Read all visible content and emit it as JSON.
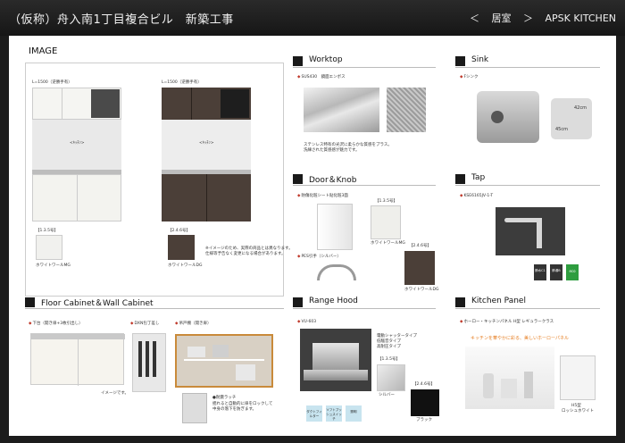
{
  "header": {
    "title": "（仮称）舟入南1丁目複合ビル　新築工事",
    "crumb_left": "＜",
    "crumb_room": "居室",
    "crumb_right": "＞",
    "crumb_brand": "APSK KITCHEN"
  },
  "image_section": {
    "title": "IMAGE",
    "left_label": "L=1500（逆勝手有）",
    "right_label": "L=1500（逆勝手有）",
    "left_hood_text": "<ｷｯﾁﾝ>",
    "right_hood_text": "<ｷｯﾁﾝ>",
    "swatch1_code": "【1.3.5号】",
    "swatch1_name": "ホワイトワールMG",
    "swatch2_code": "【2.4.6号】",
    "swatch2_name": "ホワイトワールDG",
    "note1": "※イメージのため、実際の商品とは異なります。",
    "note2": "仕様等予告なく変更になる場合があります。"
  },
  "worktop": {
    "title": "Worktop",
    "spec": "SUS430　鏡面エンボス",
    "desc1": "ステンレス特有の光沢に柔らかな質感をプラス。",
    "desc2": "洗練された質感感が魅力です。"
  },
  "sink": {
    "title": "Sink",
    "spec": "Fシンク",
    "dim_w": "42cm",
    "dim_h": "45cm"
  },
  "door": {
    "title": "Door＆Knob",
    "spec": "防傷化粧シート貼化粧3面",
    "code1": "【1.3.5号】",
    "name1": "ホワイトワールMG",
    "code2": "【2.4.6号】",
    "name2": "ホワイトワールDG",
    "knob": "PES引手（シルバー）"
  },
  "tap": {
    "title": "Tap",
    "spec": "KSE6165JV-1-T",
    "badge1": "節水C1",
    "badge2": "節湯B",
    "badge3": "eco"
  },
  "floor_cabinet": {
    "title": "Floor Cabinet＆Wall Cabinet",
    "spec1": "下台（開き扉+3枚引出し）",
    "spec2": "DXN包丁差し",
    "spec3": "吊戸棚（開き扉）",
    "caption1": "イメージです。",
    "caption2": "●耐震ラッチ",
    "caption3": "揺れると自動的に扉をロックして",
    "caption4": "中身の落下を防ぎます。"
  },
  "range_hood": {
    "title": "Range Hood",
    "spec": "VU-603",
    "feat1": "電動シャッタータイプ",
    "feat2": "低騒音タイプ",
    "feat3": "高耐圧タイプ",
    "btn1": "ダクトフィルター",
    "btn2": "ソフトプッシュスイッチ",
    "btn3": "照明",
    "code1": "【1.3.5号】",
    "name1": "シルバー",
    "code2": "【2.4.6号】",
    "name2": "ブラック"
  },
  "kitchen_panel": {
    "title": "Kitchen Panel",
    "spec": "ホーロー・キッチンパネル H型  レギュラークラス",
    "highlight": "キッチンを華やかに彩る、美しいホーローパネル",
    "code": "H5型",
    "name": "ロッシュホワイト"
  }
}
